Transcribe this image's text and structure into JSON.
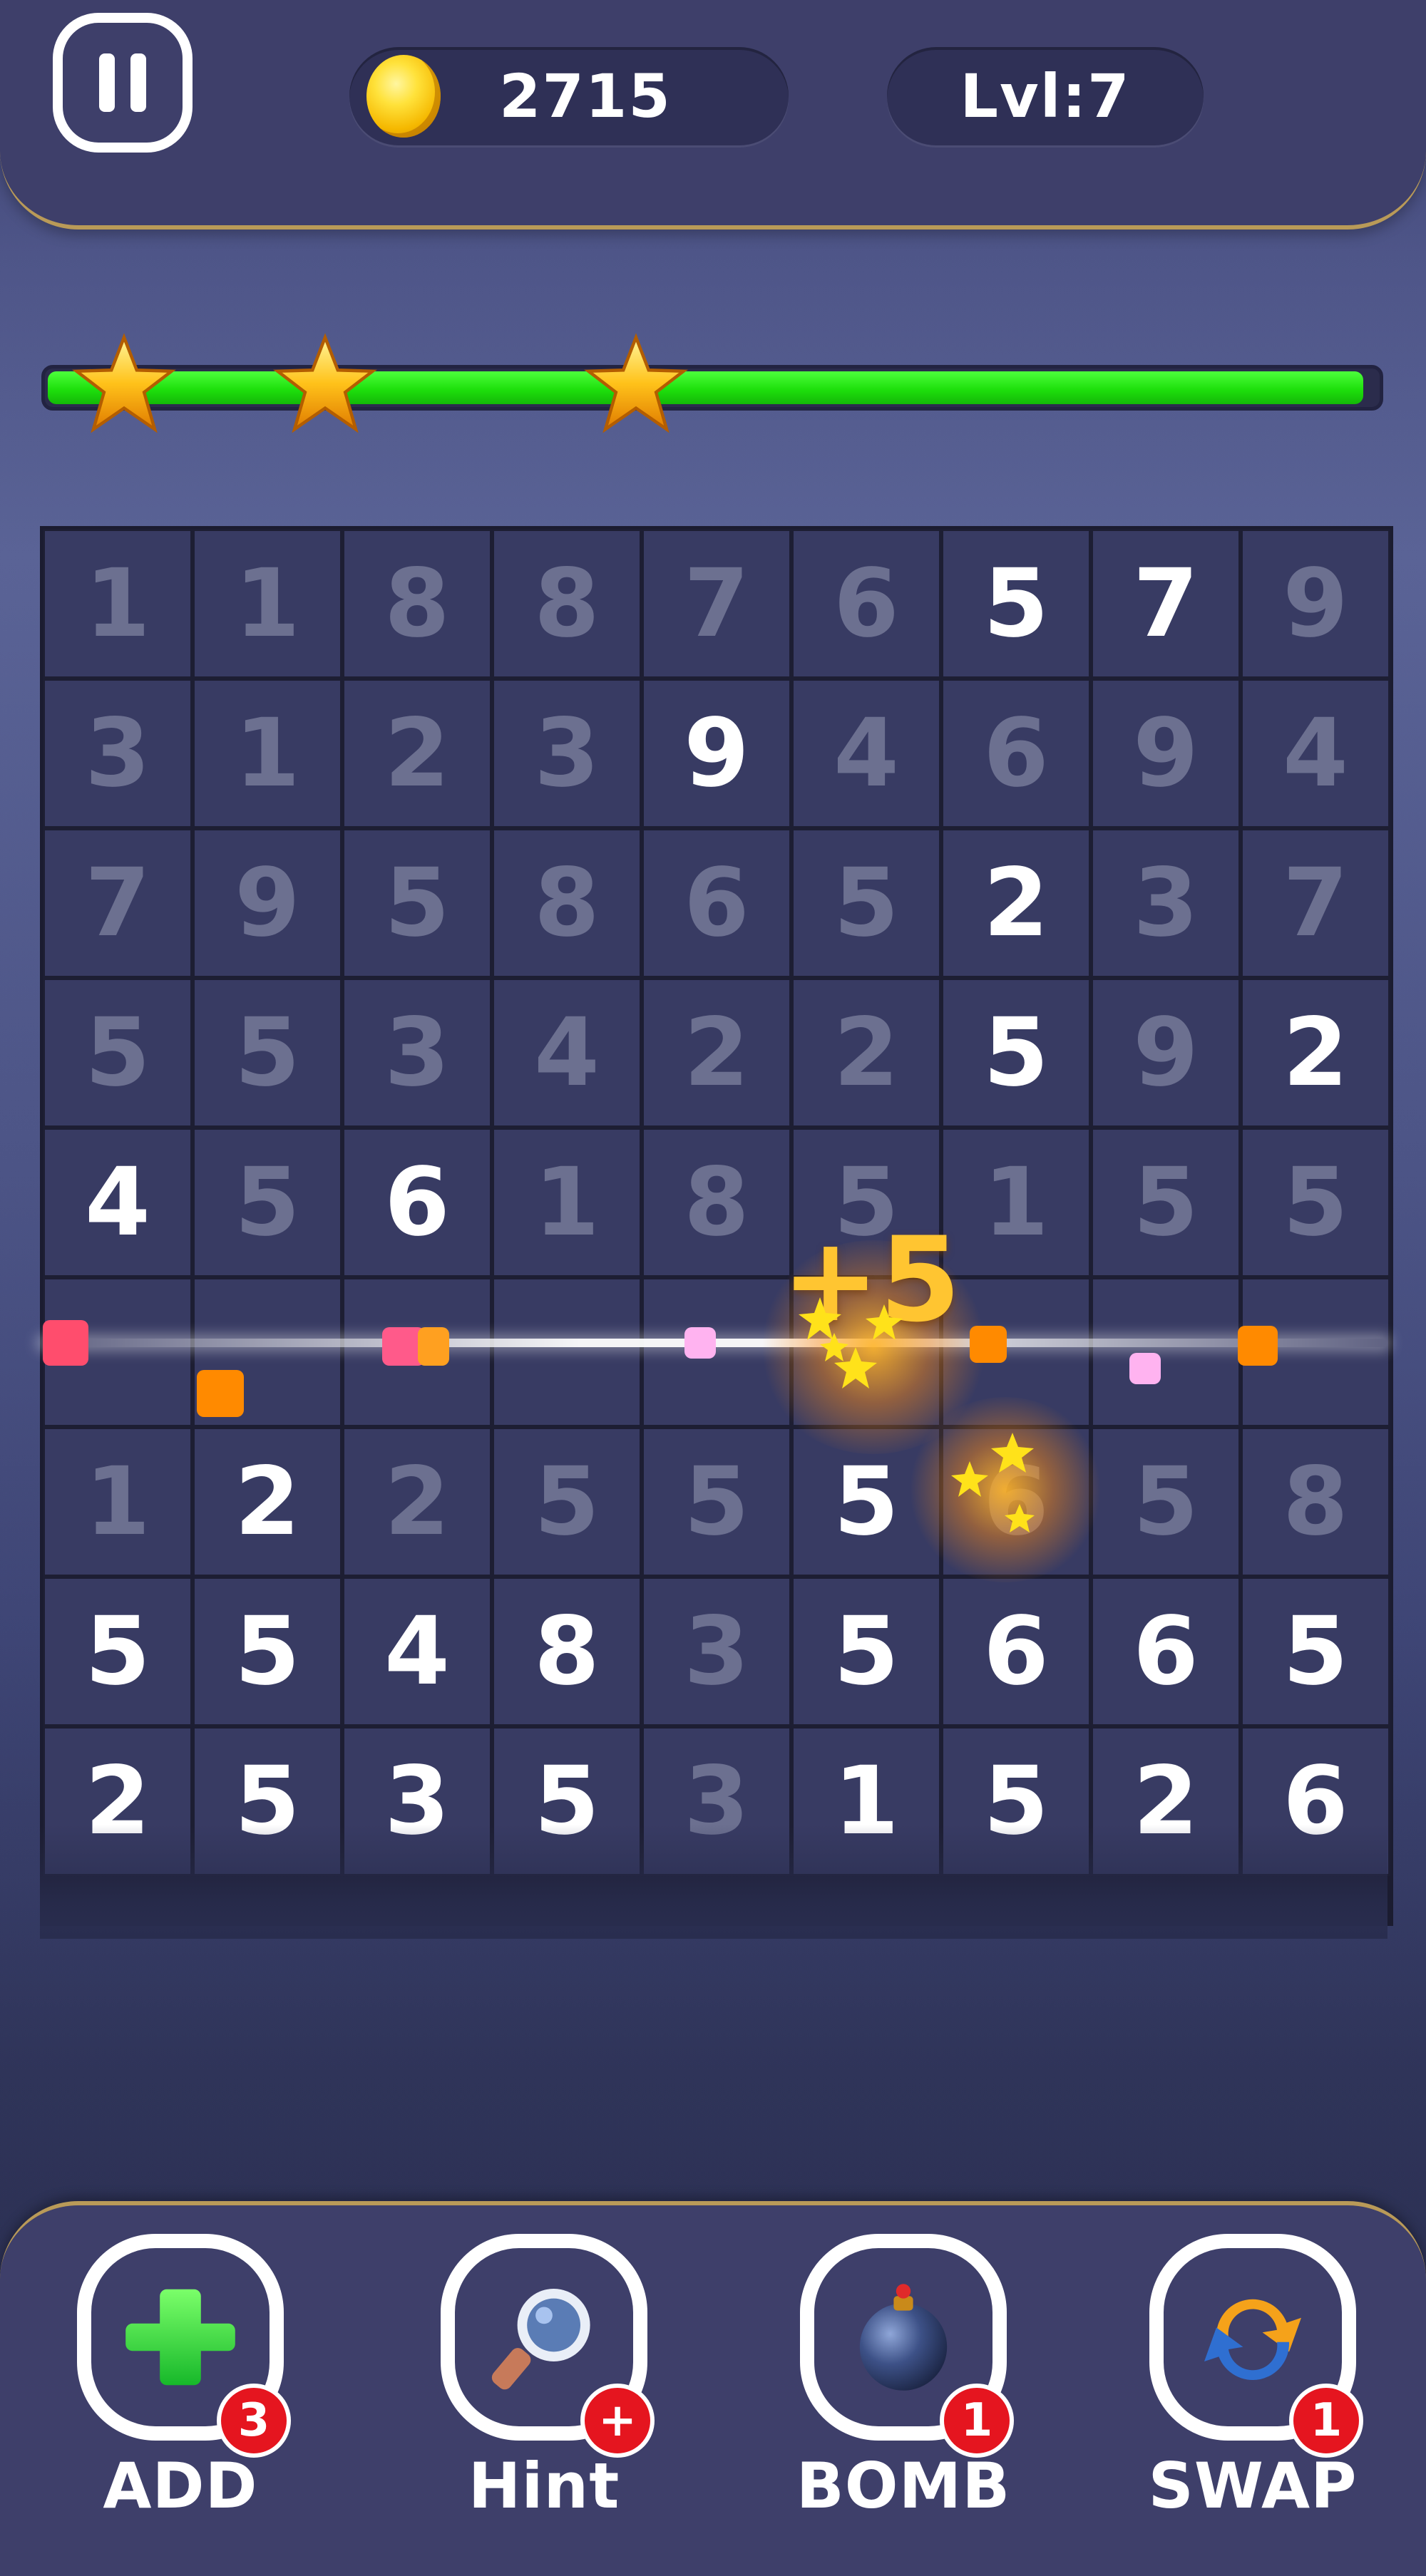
{
  "hud": {
    "coins": "2715",
    "level": "Lvl:7",
    "pause_icon": "pause-icon",
    "coin_icon": "gold-coin-icon"
  },
  "progress": {
    "fill_fraction": 0.99,
    "stars_earned": 3,
    "star_icon": "star-icon",
    "fill_color": "#22e010"
  },
  "board": {
    "rows": [
      [
        {
          "v": "1",
          "s": "dim"
        },
        {
          "v": "1",
          "s": "dim"
        },
        {
          "v": "8",
          "s": "dim"
        },
        {
          "v": "8",
          "s": "dim"
        },
        {
          "v": "7",
          "s": "dim"
        },
        {
          "v": "6",
          "s": "dim"
        },
        {
          "v": "5",
          "s": "bright"
        },
        {
          "v": "7",
          "s": "bright"
        },
        {
          "v": "9",
          "s": "dim"
        }
      ],
      [
        {
          "v": "3",
          "s": "dim"
        },
        {
          "v": "1",
          "s": "dim"
        },
        {
          "v": "2",
          "s": "dim"
        },
        {
          "v": "3",
          "s": "dim"
        },
        {
          "v": "9",
          "s": "bright"
        },
        {
          "v": "4",
          "s": "dim"
        },
        {
          "v": "6",
          "s": "dim"
        },
        {
          "v": "9",
          "s": "dim"
        },
        {
          "v": "4",
          "s": "dim"
        }
      ],
      [
        {
          "v": "7",
          "s": "dim"
        },
        {
          "v": "9",
          "s": "dim"
        },
        {
          "v": "5",
          "s": "dim"
        },
        {
          "v": "8",
          "s": "dim"
        },
        {
          "v": "6",
          "s": "dim"
        },
        {
          "v": "5",
          "s": "dim"
        },
        {
          "v": "2",
          "s": "bright"
        },
        {
          "v": "3",
          "s": "dim"
        },
        {
          "v": "7",
          "s": "dim"
        }
      ],
      [
        {
          "v": "5",
          "s": "dim"
        },
        {
          "v": "5",
          "s": "dim"
        },
        {
          "v": "3",
          "s": "dim"
        },
        {
          "v": "4",
          "s": "dim"
        },
        {
          "v": "2",
          "s": "dim"
        },
        {
          "v": "2",
          "s": "dim"
        },
        {
          "v": "5",
          "s": "bright"
        },
        {
          "v": "9",
          "s": "dim"
        },
        {
          "v": "2",
          "s": "bright"
        }
      ],
      [
        {
          "v": "4",
          "s": "bright"
        },
        {
          "v": "5",
          "s": "dim"
        },
        {
          "v": "6",
          "s": "bright"
        },
        {
          "v": "1",
          "s": "dim"
        },
        {
          "v": "8",
          "s": "dim"
        },
        {
          "v": "5",
          "s": "dim"
        },
        {
          "v": "1",
          "s": "dim"
        },
        {
          "v": "5",
          "s": "dim"
        },
        {
          "v": "5",
          "s": "dim"
        }
      ],
      [
        {
          "v": "",
          "s": "cleared"
        },
        {
          "v": "",
          "s": "cleared"
        },
        {
          "v": "",
          "s": "cleared"
        },
        {
          "v": "",
          "s": "cleared"
        },
        {
          "v": "",
          "s": "cleared"
        },
        {
          "v": "",
          "s": "cleared"
        },
        {
          "v": "",
          "s": "cleared"
        },
        {
          "v": "",
          "s": "cleared"
        },
        {
          "v": "",
          "s": "cleared"
        }
      ],
      [
        {
          "v": "1",
          "s": "dim"
        },
        {
          "v": "2",
          "s": "bright"
        },
        {
          "v": "2",
          "s": "dim"
        },
        {
          "v": "5",
          "s": "dim"
        },
        {
          "v": "5",
          "s": "dim"
        },
        {
          "v": "5",
          "s": "bright"
        },
        {
          "v": "6",
          "s": "dim"
        },
        {
          "v": "5",
          "s": "dim"
        },
        {
          "v": "8",
          "s": "dim"
        }
      ],
      [
        {
          "v": "5",
          "s": "bright"
        },
        {
          "v": "5",
          "s": "bright"
        },
        {
          "v": "4",
          "s": "bright"
        },
        {
          "v": "8",
          "s": "bright"
        },
        {
          "v": "3",
          "s": "dim"
        },
        {
          "v": "5",
          "s": "bright"
        },
        {
          "v": "6",
          "s": "bright"
        },
        {
          "v": "6",
          "s": "bright"
        },
        {
          "v": "5",
          "s": "bright"
        }
      ],
      [
        {
          "v": "2",
          "s": "bright"
        },
        {
          "v": "5",
          "s": "bright"
        },
        {
          "v": "3",
          "s": "bright"
        },
        {
          "v": "5",
          "s": "bright"
        },
        {
          "v": "3",
          "s": "dim"
        },
        {
          "v": "1",
          "s": "bright"
        },
        {
          "v": "5",
          "s": "bright"
        },
        {
          "v": "2",
          "s": "bright"
        },
        {
          "v": "6",
          "s": "bright"
        }
      ]
    ],
    "score_popup": "+5"
  },
  "tools": [
    {
      "label": "ADD",
      "icon": "green-plus-icon",
      "badge": "3"
    },
    {
      "label": "Hint",
      "icon": "magnifier-icon",
      "badge": "+"
    },
    {
      "label": "BOMB",
      "icon": "bomb-icon",
      "badge": "1"
    },
    {
      "label": "SWAP",
      "icon": "swap-arrows-icon",
      "badge": "1"
    }
  ],
  "colors": {
    "accent_gold": "#b99a58",
    "badge_red": "#e5151f",
    "popup_gold": "#ffc531"
  }
}
